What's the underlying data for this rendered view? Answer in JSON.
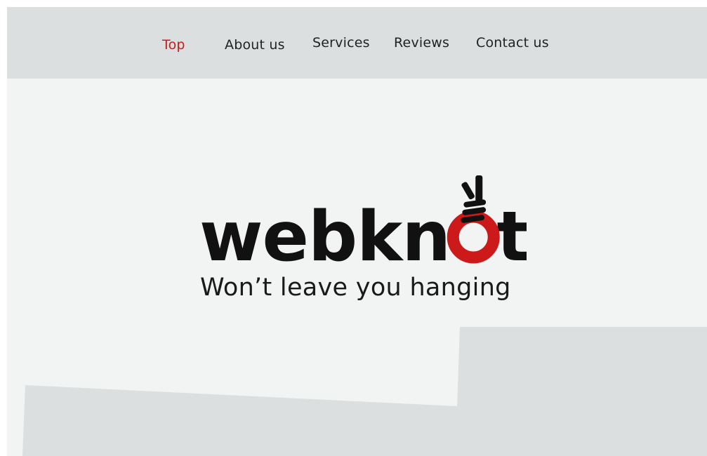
{
  "nav": {
    "items": [
      {
        "label": "Top",
        "active": true
      },
      {
        "label": "About us",
        "active": false
      },
      {
        "label": "Services",
        "active": false
      },
      {
        "label": "Reviews",
        "active": false
      },
      {
        "label": "Contact us",
        "active": false
      }
    ]
  },
  "hero": {
    "logo_text": "webknot",
    "tagline": "Won’t leave you hanging",
    "logo_icon": "knot-hand-icon"
  },
  "colors": {
    "accent": "#cc1a1a",
    "nav_background": "#dcdfe0",
    "page_background": "#f2f3f3",
    "text": "#111111",
    "shape": "#dcdfe0"
  }
}
